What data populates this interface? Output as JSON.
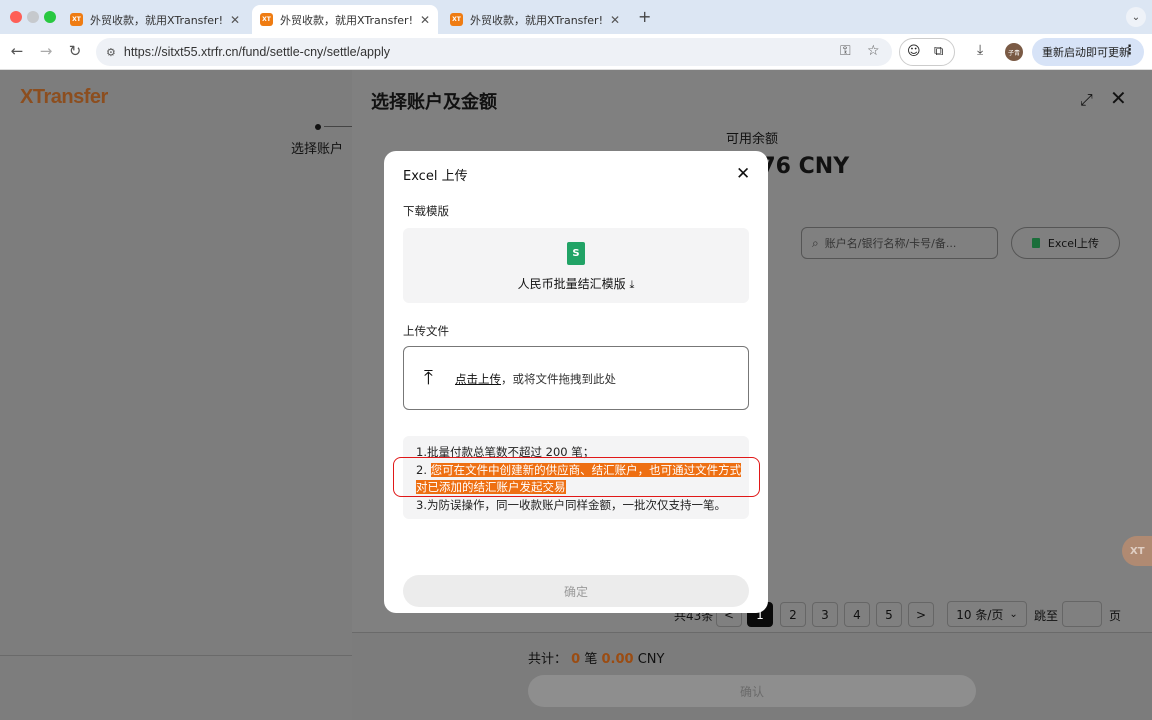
{
  "browser": {
    "tabs": [
      {
        "favicon": "XT",
        "title": "外贸收款，就用XTransfer!"
      },
      {
        "favicon": "XT",
        "title": "外贸收款，就用XTransfer!"
      },
      {
        "favicon": "XT",
        "title": "外贸收款，就用XTransfer!"
      }
    ],
    "url": "https://sitxt55.xtrfr.cn/fund/settle-cny/settle/apply",
    "profile_initials": "子青",
    "update_label": "重新启动即可更新"
  },
  "left": {
    "logo": "XTransfer",
    "step_label": "选择账户"
  },
  "panel": {
    "title": "选择账户及金额",
    "balance_label": "可用余额",
    "balance_amount": ".76 CNY",
    "search_placeholder": "账户名/银行名称/卡号/备...",
    "excel_upload_label": "Excel上传",
    "pagination": {
      "total_text": "共43条",
      "pages": [
        "1",
        "2",
        "3",
        "4",
        "5"
      ],
      "current_page": 1,
      "page_size": "10 条/页",
      "jump_label": "跳至",
      "page_suffix": "页"
    },
    "footer": {
      "total_label": "共计：",
      "count": "0",
      "count_unit": "笔",
      "amount": "0.00",
      "currency": "CNY",
      "confirm_label": "确认"
    },
    "helper_badge": "XT"
  },
  "modal": {
    "title": "Excel 上传",
    "download_section": "下载模版",
    "template_label": "人民币批量结汇模版",
    "upload_section": "上传文件",
    "upload_link": "点击上传",
    "upload_hint": "，或将文件拖拽到此处",
    "notes": {
      "line1": "1.批量付款总笔数不超过 200 笔；",
      "line2_prefix": "2. ",
      "line2_a": "您可在文件中创建新的供应商、结汇账户，也可通过文件方式",
      "line2_b": "对已添加的结汇账户发起交易",
      "line3": "3.为防误操作，同一收款账户同样金额，一批次仅支持一笔。"
    },
    "ok_label": "确定"
  },
  "colors": {
    "brand_orange": "#ef7c12",
    "highlight": "#ee6f12",
    "annotation_red": "#e01818",
    "excel_green": "#21a366"
  }
}
